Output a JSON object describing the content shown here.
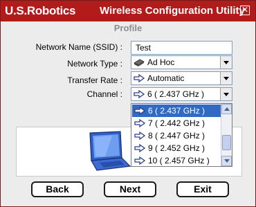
{
  "titlebar": {
    "brand": "U.S.Robotics",
    "title": "Wireless Configuration Utility",
    "close_glyph": "✕"
  },
  "page_title": "Profile",
  "form": {
    "ssid_label": "Network Name (SSID) :",
    "ssid_value": "Test",
    "type_label": "Network Type :",
    "type_value": "Ad Hoc",
    "rate_label": "Transfer Rate :",
    "rate_value": "Automatic",
    "channel_label": "Channel :",
    "channel_value": "6 ( 2.437 GHz )"
  },
  "channel_options": [
    {
      "label": "6 ( 2.437 GHz )",
      "selected": true
    },
    {
      "label": "7 ( 2.442 GHz )",
      "selected": false
    },
    {
      "label": "8 ( 2.447 GHz )",
      "selected": false
    },
    {
      "label": "9 ( 2.452 GHz )",
      "selected": false
    },
    {
      "label": "10 ( 2.457 GHz )",
      "selected": false
    }
  ],
  "buttons": {
    "back": "Back",
    "next": "Next",
    "exit": "Exit"
  },
  "colors": {
    "titlebar": "#b31b1b",
    "selection": "#316ac5"
  },
  "icons": {
    "type_icon": "network-device-icon",
    "option_icon": "arrow-right-icon",
    "illustration": "laptop-icon"
  }
}
